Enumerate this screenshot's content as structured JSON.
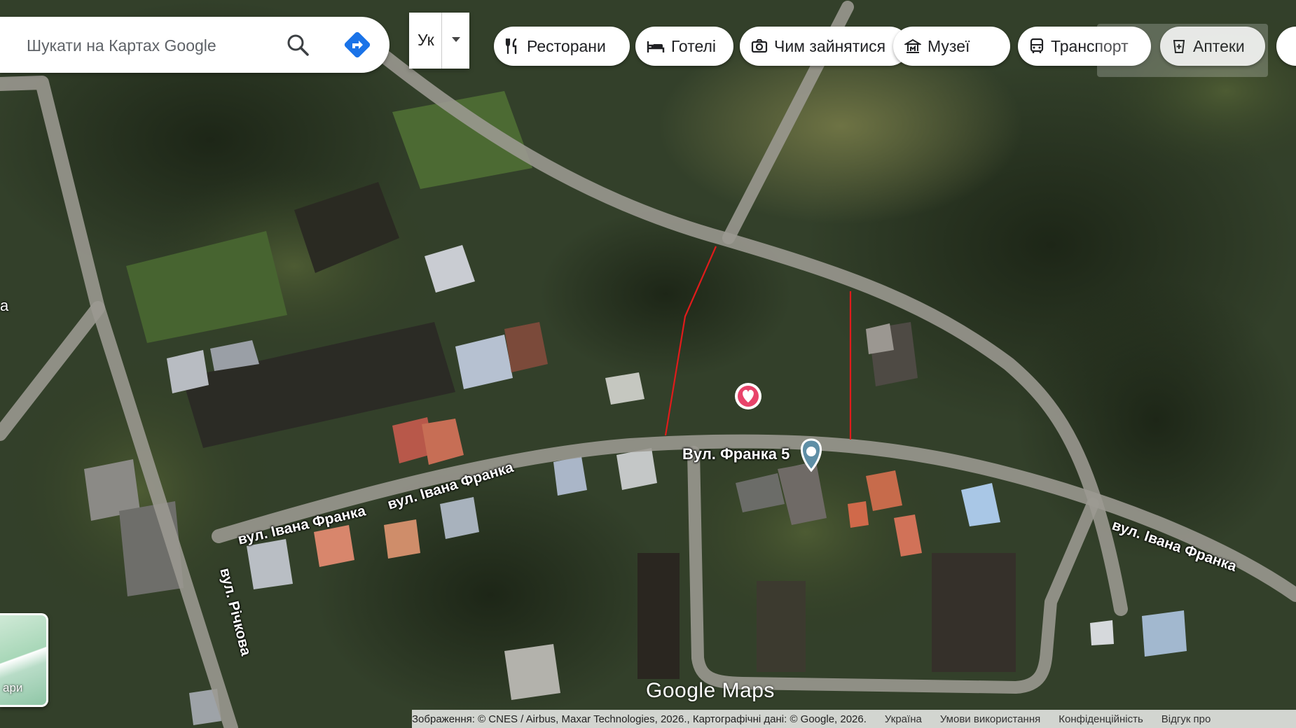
{
  "search": {
    "placeholder": "Шукати на Картах Google"
  },
  "language": {
    "label": "Ук"
  },
  "categories": [
    {
      "label": "Ресторани",
      "icon": "fork-knife-icon"
    },
    {
      "label": "Готелі",
      "icon": "bed-icon"
    },
    {
      "label": "Чим зайнятися",
      "icon": "camera-icon"
    },
    {
      "label": "Музеї",
      "icon": "museum-icon"
    },
    {
      "label": "Транспорт",
      "icon": "bus-icon"
    },
    {
      "label": "Аптеки",
      "icon": "pharmacy-icon"
    }
  ],
  "map": {
    "marker_label": "Вул. Франка 5",
    "streets": [
      "вул. Івана Франка",
      "вул. Івана Франка",
      "вул. Івана Франка",
      "вул. Річкова"
    ],
    "partial_place_label": "а",
    "layer_label": "ари"
  },
  "logo": "Google Maps",
  "footer": {
    "attribution": "Зображення: © CNES / Airbus, Maxar Technologies, 2026., Картографічні дані: © Google, 2026.",
    "links": [
      "Україна",
      "Умови використання",
      "Конфіденційність",
      "Відгук про"
    ]
  },
  "colors": {
    "marker_heart": "#e8436a",
    "marker_pin": "#5f8fa6",
    "boundary": "#e01b1b",
    "road": "#9a9890",
    "direction": "#1a73e8"
  }
}
